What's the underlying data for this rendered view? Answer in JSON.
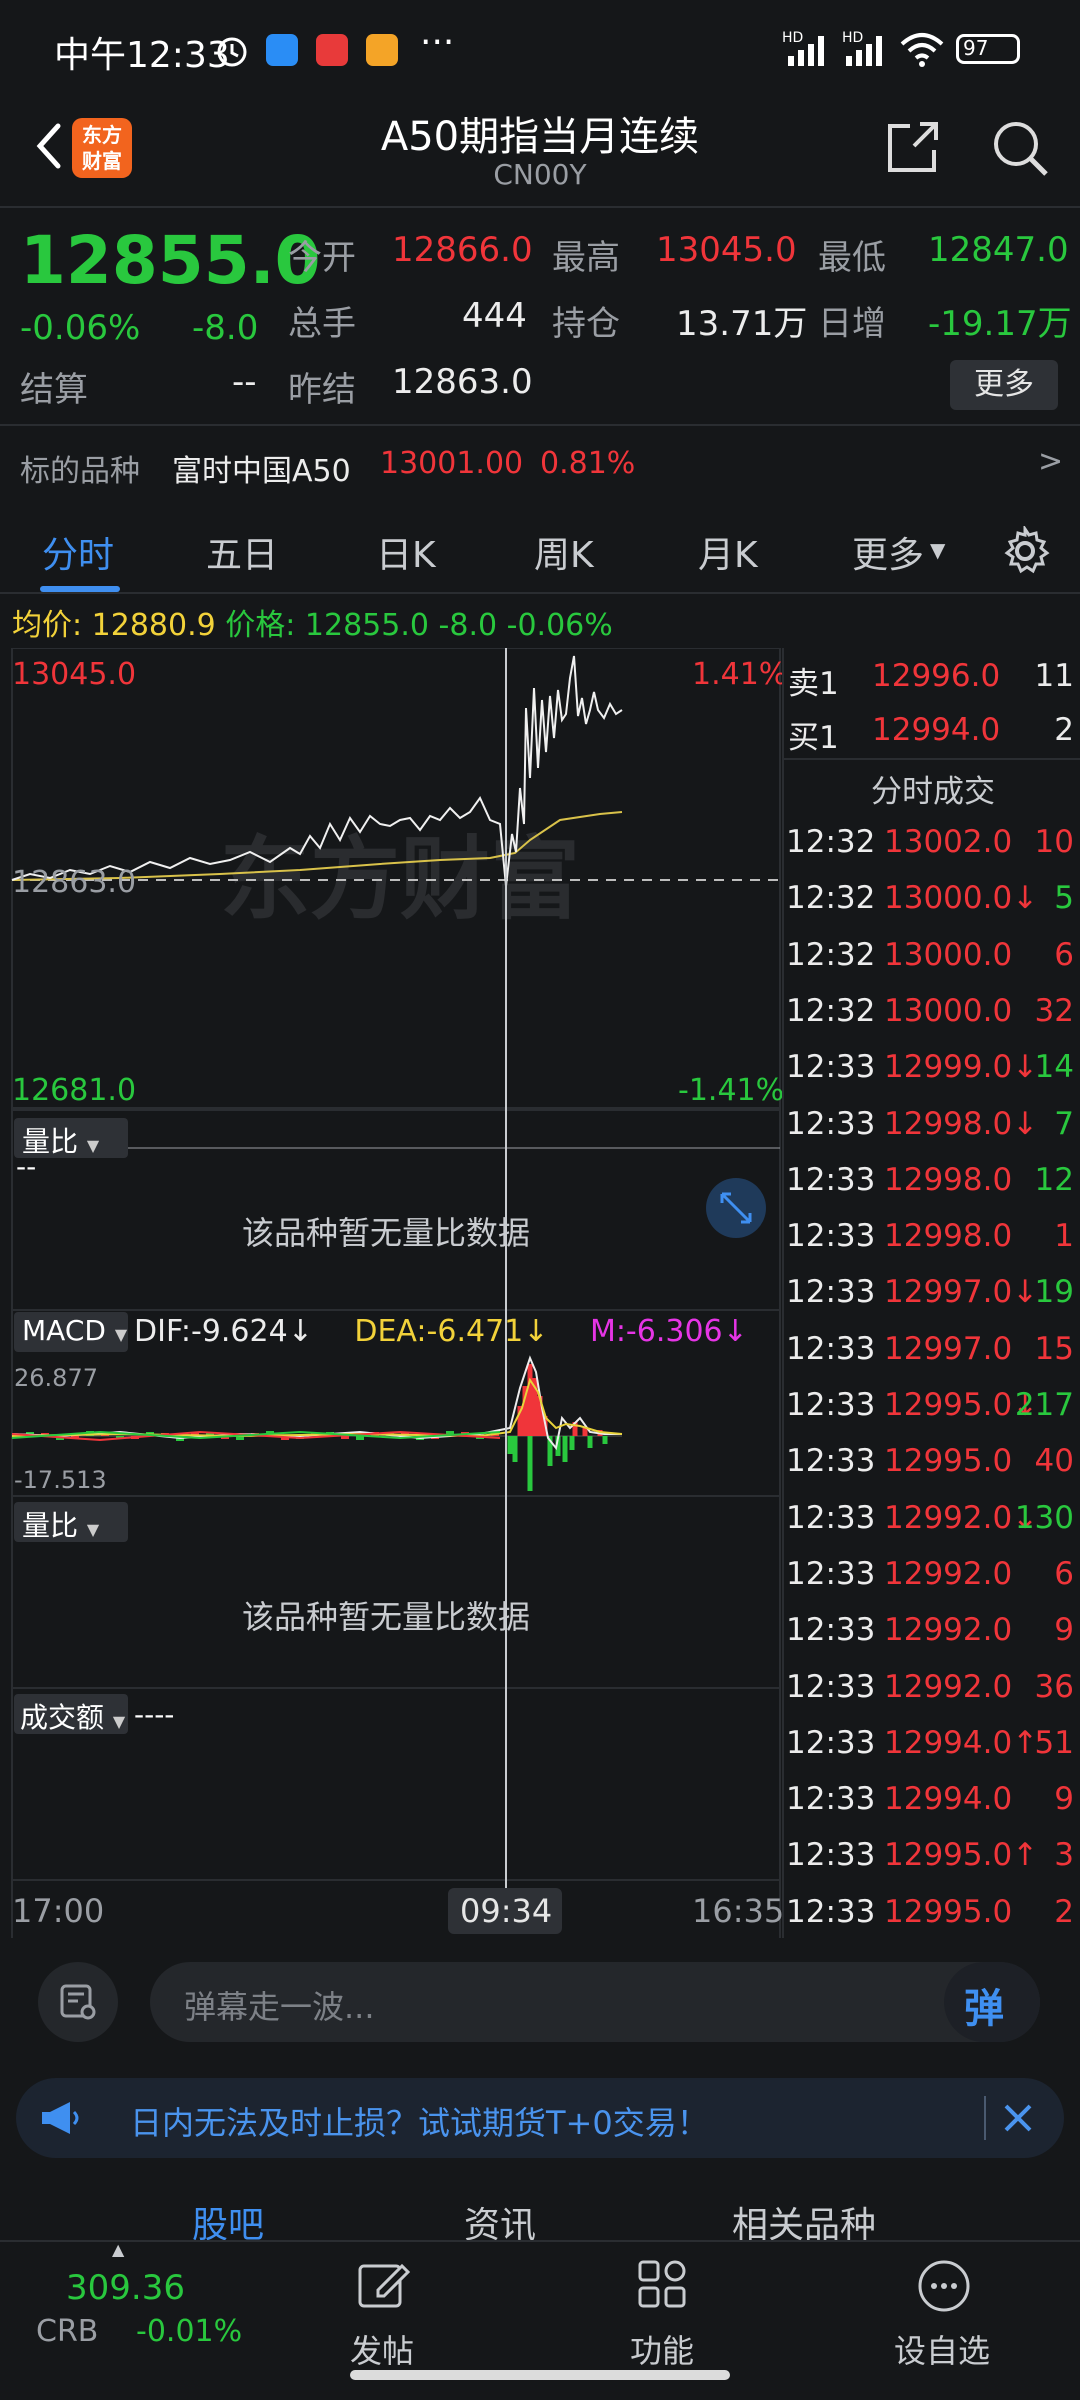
{
  "status": {
    "time": "中午12:33",
    "more": "···",
    "battery": "97",
    "hd1": "HD",
    "hd2": "HD"
  },
  "header": {
    "logo_line1": "东方",
    "logo_line2": "财富",
    "title": "A50期指当月连续",
    "code": "CN00Y"
  },
  "quote": {
    "price": "12855.0",
    "change_pct": "-0.06%",
    "change": "-8.0",
    "open_label": "今开",
    "open": "12866.0",
    "high_label": "最高",
    "high": "13045.0",
    "low_label": "最低",
    "low": "12847.0",
    "volume_label": "总手",
    "volume": "444",
    "position_label": "持仓",
    "position": "13.71万",
    "daily_inc_label": "日增",
    "daily_inc": "-19.17万",
    "settle_label": "结算",
    "settle": "--",
    "prev_settle_label": "昨结",
    "prev_settle": "12863.0",
    "more_label": "更多"
  },
  "underlying": {
    "label": "标的品种",
    "name": "富时中国A50",
    "price": "13001.00",
    "pct": "0.81%",
    "arrow": ">"
  },
  "tabs": [
    "分时",
    "五日",
    "日K",
    "周K",
    "月K",
    "更多"
  ],
  "info": {
    "avg_label": "均价:",
    "avg": "12880.9",
    "price_label": "价格:",
    "price": "12855.0",
    "change": "-8.0",
    "pct": "-0.06%"
  },
  "chart": {
    "top_left": "13045.0",
    "top_right": "1.41%",
    "mid_left": "12863.0",
    "bottom_left": "12681.0",
    "bottom_right": "-1.41%",
    "volume_ratio_label": "量比",
    "volume_ratio_value": "--",
    "no_data": "该品种暂无量比数据",
    "macd_label": "MACD",
    "dif": "DIF:-9.624↓",
    "dea": "DEA:-6.471↓",
    "m": "M:-6.306↓",
    "macd_top": "26.877",
    "macd_bottom": "-17.513",
    "volume_ratio_label2": "量比",
    "no_data2": "该品种暂无量比数据",
    "turnover_label": "成交额",
    "turnover_value": "----",
    "time_start": "17:00",
    "time_cursor": "09:34",
    "time_end": "16:35",
    "watermark": "东方财富"
  },
  "orderbook": {
    "sell_label": "卖1",
    "sell_price": "12996.0",
    "sell_qty": "11",
    "buy_label": "买1",
    "buy_price": "12994.0",
    "buy_qty": "2",
    "ticks_label": "分时成交"
  },
  "trades": [
    {
      "time": "12:32",
      "price": "13002.0",
      "vol": "10",
      "vc": "red"
    },
    {
      "time": "12:32",
      "price": "13000.0↓",
      "vol": "5",
      "vc": "green"
    },
    {
      "time": "12:32",
      "price": "13000.0",
      "vol": "6",
      "vc": "red"
    },
    {
      "time": "12:32",
      "price": "13000.0",
      "vol": "32",
      "vc": "red"
    },
    {
      "time": "12:33",
      "price": "12999.0↓",
      "vol": "14",
      "vc": "green"
    },
    {
      "time": "12:33",
      "price": "12998.0↓",
      "vol": "7",
      "vc": "green"
    },
    {
      "time": "12:33",
      "price": "12998.0",
      "vol": "12",
      "vc": "green"
    },
    {
      "time": "12:33",
      "price": "12998.0",
      "vol": "1",
      "vc": "red"
    },
    {
      "time": "12:33",
      "price": "12997.0↓",
      "vol": "19",
      "vc": "green"
    },
    {
      "time": "12:33",
      "price": "12997.0",
      "vol": "15",
      "vc": "red"
    },
    {
      "time": "12:33",
      "price": "12995.0↓",
      "vol": "217",
      "vc": "green"
    },
    {
      "time": "12:33",
      "price": "12995.0",
      "vol": "40",
      "vc": "red"
    },
    {
      "time": "12:33",
      "price": "12992.0↓",
      "vol": "130",
      "vc": "green"
    },
    {
      "time": "12:33",
      "price": "12992.0",
      "vol": "6",
      "vc": "red"
    },
    {
      "time": "12:33",
      "price": "12992.0",
      "vol": "9",
      "vc": "red"
    },
    {
      "time": "12:33",
      "price": "12992.0",
      "vol": "36",
      "vc": "red"
    },
    {
      "time": "12:33",
      "price": "12994.0↑",
      "vol": "51",
      "vc": "red"
    },
    {
      "time": "12:33",
      "price": "12994.0",
      "vol": "9",
      "vc": "red"
    },
    {
      "time": "12:33",
      "price": "12995.0↑",
      "vol": "3",
      "vc": "red"
    },
    {
      "time": "12:33",
      "price": "12995.0",
      "vol": "2",
      "vc": "red"
    }
  ],
  "input": {
    "placeholder": "弹幕走一波...",
    "danmu": "弹"
  },
  "promo": {
    "text": "日内无法及时止损？试试期货T+0交易！"
  },
  "bottom_tabs": [
    "股吧",
    "资讯",
    "相关品种"
  ],
  "bottom_nav": {
    "ticker_price": "309.36",
    "ticker_name": "CRB",
    "ticker_pct": "-0.01%",
    "post": "发帖",
    "functions": "功能",
    "set_watch": "设自选"
  },
  "colors": {
    "up": "#f0353a",
    "down": "#29c83e",
    "accent": "#3f8ff0",
    "avg_line": "#d9c24a",
    "background": "#151719"
  }
}
